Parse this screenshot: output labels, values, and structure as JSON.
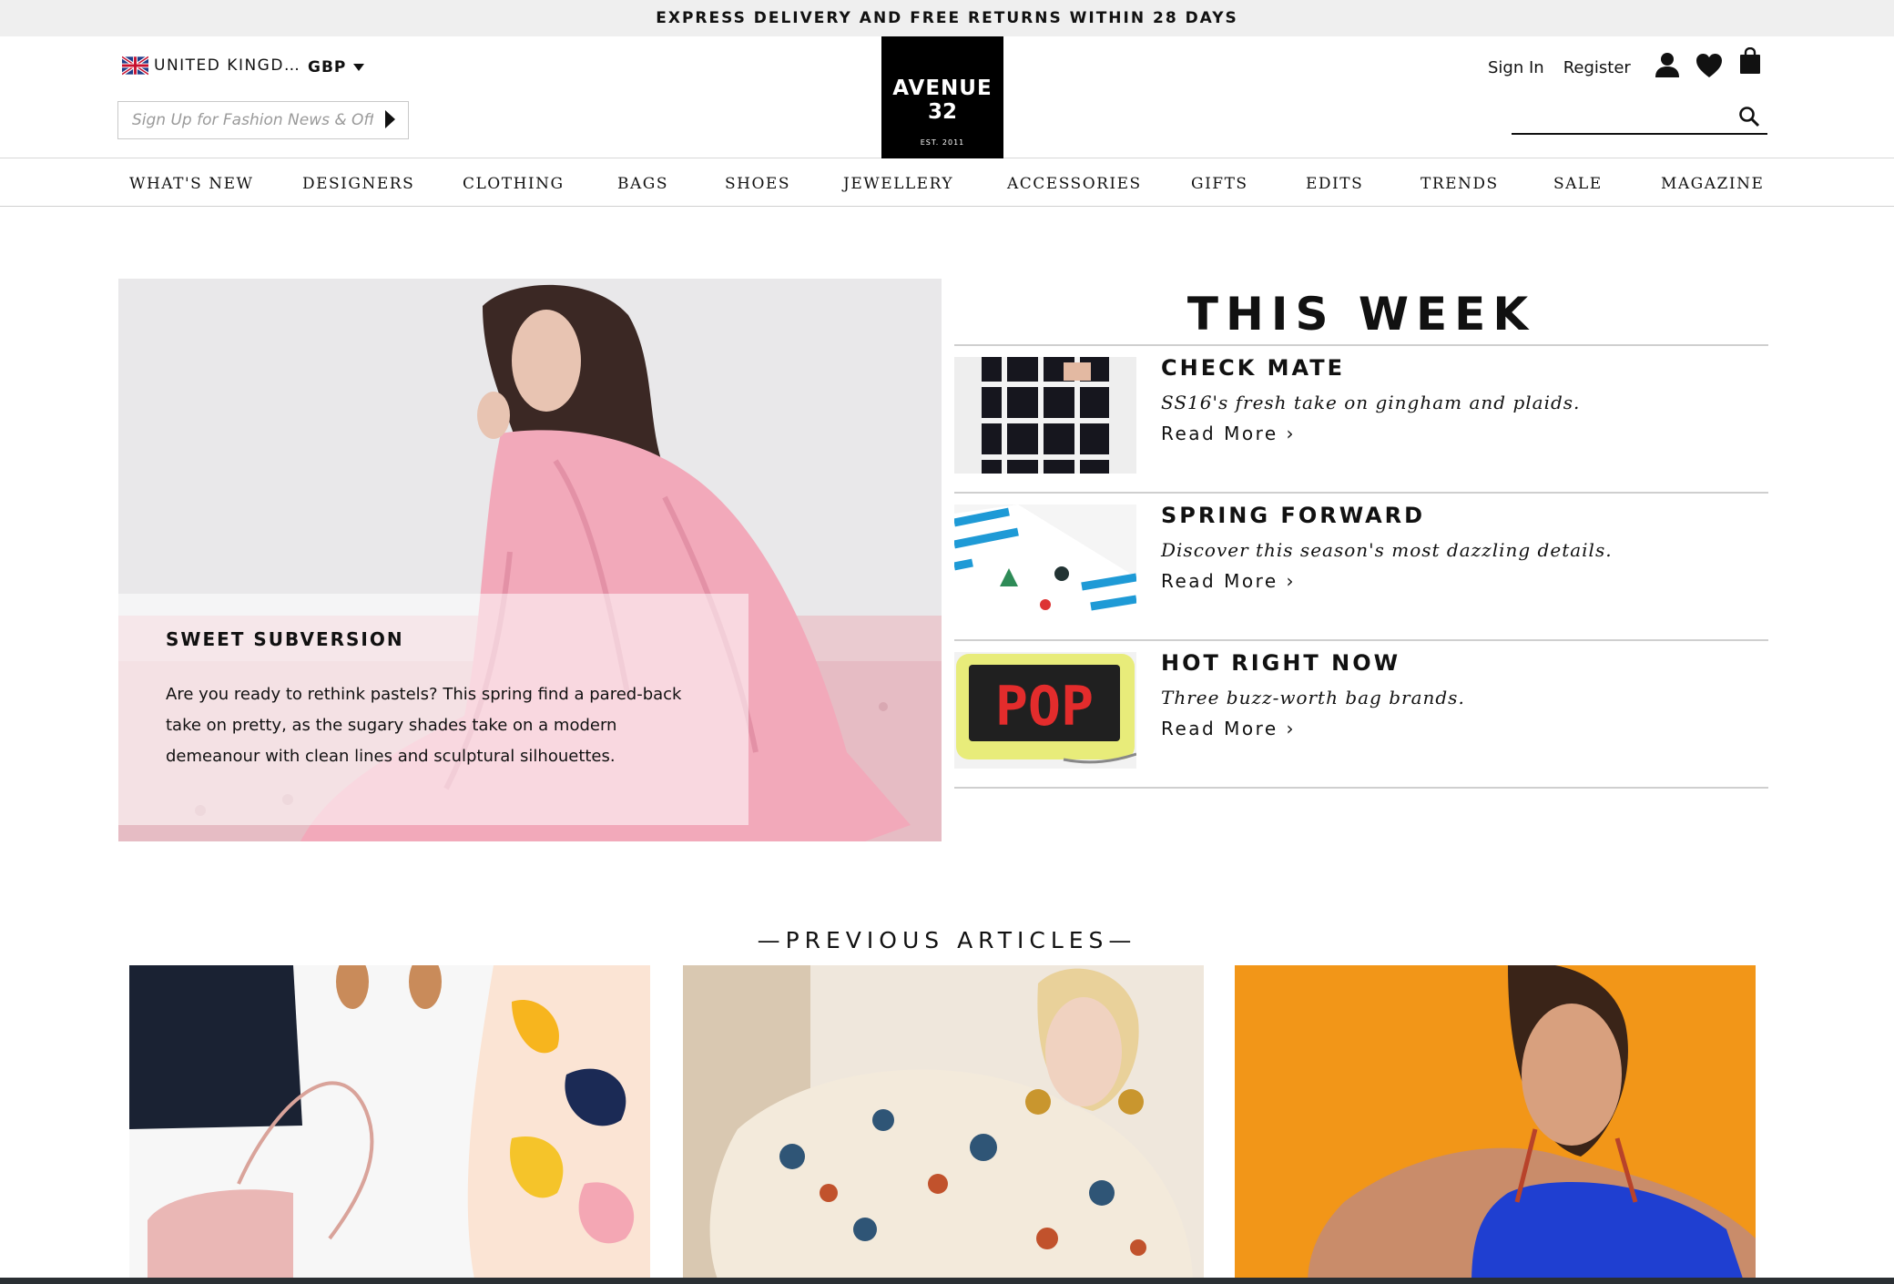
{
  "promo": {
    "text": "EXPRESS DELIVERY AND FREE RETURNS WITHIN 28 DAYS"
  },
  "header": {
    "country": "UNITED KINGD…",
    "currency": "GBP",
    "signup_placeholder": "Sign Up for Fashion News & Offers",
    "logo": {
      "line1": "AVENUE",
      "line2": "32",
      "est": "EST. 2011"
    },
    "sign_in": "Sign In",
    "register": "Register",
    "icons": [
      "user-icon",
      "heart-icon",
      "bag-icon",
      "search-icon"
    ]
  },
  "nav": {
    "items": [
      "WHAT'S NEW",
      "DESIGNERS",
      "CLOTHING",
      "BAGS",
      "SHOES",
      "JEWELLERY",
      "ACCESSORIES",
      "GIFTS",
      "EDITS",
      "TRENDS",
      "SALE",
      "MAGAZINE"
    ]
  },
  "hero": {
    "title": "SWEET SUBVERSION",
    "body": "Are you ready to rethink pastels? This spring find a pared-back take on pretty, as the sugary shades take on a modern demeanour with clean lines and sculptural silhouettes."
  },
  "this_week": {
    "title": "THIS WEEK",
    "items": [
      {
        "title": "CHECK MATE",
        "desc": "SS16's fresh take on gingham and plaids.",
        "more": "Read More ›"
      },
      {
        "title": "SPRING FORWARD",
        "desc": "Discover this season's most dazzling details.",
        "more": "Read More ›"
      },
      {
        "title": "HOT RIGHT NOW",
        "desc": "Three buzz-worth bag brands.",
        "more": "Read More ›"
      }
    ]
  },
  "previous": {
    "title": "—PREVIOUS ARTICLES—"
  },
  "pop_bag_text": "POP",
  "colors": {
    "brand_black": "#000000",
    "promo_bg": "#efefef",
    "article3_bg": "#f29618"
  }
}
